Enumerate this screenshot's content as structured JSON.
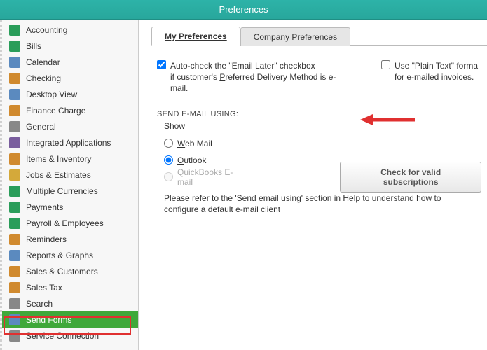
{
  "window": {
    "title": "Preferences"
  },
  "sidebar": {
    "items": [
      {
        "label": "Accounting",
        "iconColor": "#2a9d5a"
      },
      {
        "label": "Bills",
        "iconColor": "#2a9d5a"
      },
      {
        "label": "Calendar",
        "iconColor": "#5b8abf"
      },
      {
        "label": "Checking",
        "iconColor": "#d08a2f"
      },
      {
        "label": "Desktop View",
        "iconColor": "#5b8abf"
      },
      {
        "label": "Finance Charge",
        "iconColor": "#d08a2f"
      },
      {
        "label": "General",
        "iconColor": "#888888"
      },
      {
        "label": "Integrated Applications",
        "iconColor": "#7a5e9e"
      },
      {
        "label": "Items & Inventory",
        "iconColor": "#d08a2f"
      },
      {
        "label": "Jobs & Estimates",
        "iconColor": "#d4a93a"
      },
      {
        "label": "Multiple Currencies",
        "iconColor": "#2a9d5a"
      },
      {
        "label": "Payments",
        "iconColor": "#2a9d5a"
      },
      {
        "label": "Payroll & Employees",
        "iconColor": "#2a9d5a"
      },
      {
        "label": "Reminders",
        "iconColor": "#d08a2f"
      },
      {
        "label": "Reports & Graphs",
        "iconColor": "#5b8abf"
      },
      {
        "label": "Sales & Customers",
        "iconColor": "#d08a2f"
      },
      {
        "label": "Sales Tax",
        "iconColor": "#d08a2f"
      },
      {
        "label": "Search",
        "iconColor": "#888888"
      },
      {
        "label": "Send Forms",
        "iconColor": "#5b8abf",
        "selected": true
      },
      {
        "label": "Service Connection",
        "iconColor": "#888888"
      }
    ]
  },
  "tabs": {
    "my": "My Preferences",
    "company": "Company Preferences"
  },
  "options": {
    "autoCheck": "Auto-check the \"Email Later\" checkbox if customer's Preferred Delivery Method is e-mail.",
    "plainText": "Use \"Plain Text\" format for e-mailed invoices.",
    "autoCheckChecked": true,
    "plainTextChecked": false,
    "sendUsing": "SEND E-MAIL USING:",
    "show": "Show",
    "webmail": "Web Mail",
    "outlook": "Outlook",
    "qbemail": "QuickBooks E-mail",
    "selected": "outlook",
    "validBtn": "Check for valid subscriptions",
    "help": "Please refer to the 'Send email using' section in Help to understand how to configure a default e-mail client"
  }
}
